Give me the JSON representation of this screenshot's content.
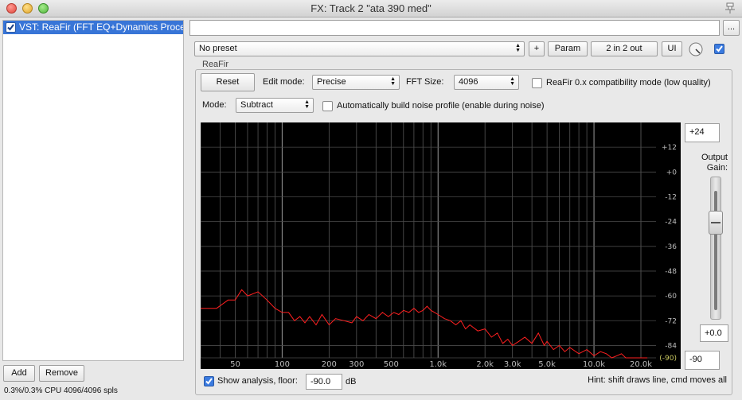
{
  "window": {
    "title": "FX: Track 2 \"ata 390 med\""
  },
  "fx_list": {
    "items": [
      {
        "label": "VST: ReaFir (FFT EQ+Dynamics Processor) (Cockos)",
        "enabled": true
      }
    ],
    "add_label": "Add",
    "remove_label": "Remove",
    "status": "0.3%/0.3% CPU 4096/4096 spls"
  },
  "toolbar": {
    "preset_value": "No preset",
    "plus_label": "+",
    "param_label": "Param",
    "io_label": "2 in 2 out",
    "ui_label": "UI",
    "more_label": "..."
  },
  "plugin": {
    "name": "ReaFir",
    "reset_label": "Reset",
    "edit_mode_label": "Edit mode:",
    "edit_mode_value": "Precise",
    "fft_size_label": "FFT Size:",
    "fft_size_value": "4096",
    "compat_label": "ReaFir 0.x compatibility mode (low quality)",
    "mode_label": "Mode:",
    "mode_value": "Subtract",
    "auto_noise_label": "Automatically build noise profile (enable during noise)",
    "top_db": "+24",
    "bottom_db": "-90",
    "output_gain_label_1": "Output",
    "output_gain_label_2": "Gain:",
    "output_gain_value": "+0.0",
    "show_analysis_label": "Show analysis, floor:",
    "floor_value": "-90.0",
    "db_label": "dB",
    "hint": "Hint: shift draws line, cmd moves all"
  },
  "chart_data": {
    "type": "line",
    "xscale": "log",
    "xlim": [
      30,
      25000
    ],
    "ylim": [
      -90,
      24
    ],
    "x_tick_labels": [
      "50",
      "100",
      "200",
      "300",
      "500",
      "1.0k",
      "2.0k",
      "3.0k",
      "5.0k",
      "10.0k",
      "20.0k"
    ],
    "x_tick_values": [
      50,
      100,
      200,
      300,
      500,
      1000,
      2000,
      3000,
      5000,
      10000,
      20000
    ],
    "y_tick_labels": [
      "+12",
      "+0",
      "-12",
      "-24",
      "-36",
      "-48",
      "-60",
      "-72",
      "-84",
      "(-90)"
    ],
    "y_tick_values": [
      12,
      0,
      -12,
      -24,
      -36,
      -48,
      -60,
      -72,
      -84,
      -90
    ],
    "series": [
      {
        "x": [
          30,
          38,
          45,
          50,
          55,
          60,
          70,
          80,
          90,
          100,
          110,
          120,
          130,
          140,
          150,
          165,
          180,
          200,
          220,
          250,
          280,
          300,
          330,
          360,
          400,
          440,
          480,
          520,
          560,
          600,
          650,
          700,
          750,
          800,
          850,
          900,
          950,
          1000,
          1100,
          1200,
          1300,
          1400,
          1500,
          1600,
          1800,
          2000,
          2200,
          2400,
          2600,
          2800,
          3000,
          3300,
          3600,
          4000,
          4400,
          4800,
          5000,
          5500,
          6000,
          6500,
          7000,
          8000,
          9000,
          10000,
          11000,
          12000,
          13000,
          14000,
          15000,
          16000,
          18000,
          20000,
          22000
        ],
        "y": [
          -66,
          -66,
          -62,
          -62,
          -57,
          -60,
          -58,
          -62,
          -66,
          -68,
          -68,
          -72,
          -70,
          -73,
          -70,
          -74,
          -69,
          -74,
          -71,
          -72,
          -73,
          -70,
          -72,
          -69,
          -71,
          -68,
          -70,
          -68,
          -69,
          -67,
          -68,
          -66,
          -68,
          -67,
          -65,
          -67,
          -68,
          -69,
          -71,
          -72,
          -74,
          -72,
          -76,
          -74,
          -77,
          -76,
          -80,
          -78,
          -83,
          -81,
          -84,
          -82,
          -80,
          -83,
          -78,
          -84,
          -82,
          -86,
          -84,
          -87,
          -85,
          -88,
          -86,
          -89,
          -87,
          -88,
          -90,
          -89,
          -88,
          -90,
          -90,
          -90,
          -90
        ],
        "color": "#ff2020"
      }
    ]
  }
}
